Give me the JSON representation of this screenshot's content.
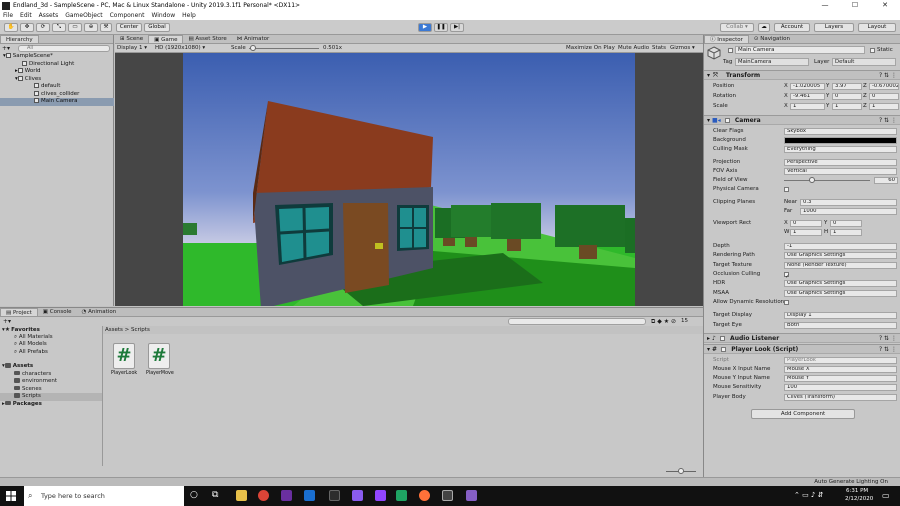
{
  "window": {
    "title": "Endland_3d - SampleScene - PC, Mac & Linux Standalone - Unity 2019.3.1f1 Personal* <DX11>",
    "controls": [
      "—",
      "☐",
      "✕"
    ]
  },
  "menu": [
    "File",
    "Edit",
    "Assets",
    "GameObject",
    "Component",
    "Window",
    "Help"
  ],
  "toolbar": {
    "pivot_label": "Center",
    "space_label": "Global",
    "collab_label": "Collab ▾",
    "account_label": "Account",
    "layers_label": "Layers",
    "layout_label": "Layout",
    "play_active": true
  },
  "hierarchy": {
    "tab_label": "Hierarchy",
    "search_placeholder": "All",
    "items": [
      {
        "label": "SampleScene*",
        "depth": 0,
        "expanded": true
      },
      {
        "label": "Directional Light",
        "depth": 1
      },
      {
        "label": "World",
        "depth": 1,
        "expandable": true
      },
      {
        "label": "Clives",
        "depth": 1,
        "expanded": true
      },
      {
        "label": "default",
        "depth": 2
      },
      {
        "label": "clives_collider",
        "depth": 2
      },
      {
        "label": "Main Camera",
        "depth": 2,
        "selected": true
      }
    ]
  },
  "view_tabs": [
    {
      "label": "Scene"
    },
    {
      "label": "Game",
      "selected": true
    },
    {
      "label": "Asset Store"
    },
    {
      "label": "Animator"
    }
  ],
  "game_bar": {
    "display": "Display 1",
    "resolution": "HD (1920x1080)",
    "scale_label": "Scale",
    "scale_value": "0.501x",
    "scale_fraction": 0.05,
    "maximize": "Maximize On Play",
    "mute": "Mute Audio",
    "stats": "Stats",
    "gizmos": "Gizmos"
  },
  "inspector": {
    "tabs": [
      {
        "label": "Inspector",
        "selected": true
      },
      {
        "label": "Navigation"
      }
    ],
    "object_name": "Main Camera",
    "static_label": "Static",
    "tag_label": "Tag",
    "tag_value": "MainCamera",
    "layer_label": "Layer",
    "layer_value": "Default",
    "transform": {
      "title": "Transform",
      "position": {
        "label": "Position",
        "x": "-1.020005",
        "y": "3.97",
        "z": "-0.670002"
      },
      "rotation": {
        "label": "Rotation",
        "x": "-9.461",
        "y": "0",
        "z": "0"
      },
      "scale": {
        "label": "Scale",
        "x": "1",
        "y": "1",
        "z": "1"
      }
    },
    "camera": {
      "title": "Camera",
      "clear_flags": {
        "label": "Clear Flags",
        "value": "Skybox"
      },
      "background": {
        "label": "Background",
        "color": "#000000"
      },
      "culling_mask": {
        "label": "Culling Mask",
        "value": "Everything"
      },
      "projection": {
        "label": "Projection",
        "value": "Perspective"
      },
      "fov_axis": {
        "label": "FOV Axis",
        "value": "Vertical"
      },
      "fov": {
        "label": "Field of View",
        "value": "60",
        "fraction": 0.33
      },
      "physical": {
        "label": "Physical Camera"
      },
      "clipping": {
        "label": "Clipping Planes",
        "near_label": "Near",
        "near": "0.3",
        "far_label": "Far",
        "far": "1000"
      },
      "viewport": {
        "label": "Viewport Rect",
        "x": "0",
        "y": "0",
        "w": "1",
        "h": "1"
      },
      "depth": {
        "label": "Depth",
        "value": "-1"
      },
      "rendering_path": {
        "label": "Rendering Path",
        "value": "Use Graphics Settings"
      },
      "target_texture": {
        "label": "Target Texture",
        "value": "None (Render Texture)"
      },
      "occlusion": {
        "label": "Occlusion Culling"
      },
      "hdr": {
        "label": "HDR",
        "value": "Use Graphics Settings"
      },
      "msaa": {
        "label": "MSAA",
        "value": "Use Graphics Settings"
      },
      "dynamic_res": {
        "label": "Allow Dynamic Resolution"
      },
      "target_display": {
        "label": "Target Display",
        "value": "Display 1"
      },
      "target_eye": {
        "label": "Target Eye",
        "value": "Both"
      }
    },
    "audio_listener": {
      "title": "Audio Listener"
    },
    "player_look": {
      "title": "Player Look (Script)",
      "script": {
        "label": "Script",
        "value": "PlayerLook"
      },
      "mouse_x": {
        "label": "Mouse X Input Name",
        "value": "Mouse X"
      },
      "mouse_y": {
        "label": "Mouse Y Input Name",
        "value": "Mouse Y"
      },
      "sensitivity": {
        "label": "Mouse Sensitivity",
        "value": "100"
      },
      "player_body": {
        "label": "Player Body",
        "value": "Clives (Transform)"
      }
    },
    "add_component": "Add Component"
  },
  "project": {
    "tabs": [
      {
        "label": "Project",
        "selected": true
      },
      {
        "label": "Console"
      },
      {
        "label": "Animation"
      }
    ],
    "tree": [
      {
        "label": "Favorites",
        "bold": true,
        "type": "fav"
      },
      {
        "label": "All Materials",
        "type": "search"
      },
      {
        "label": "All Models",
        "type": "search"
      },
      {
        "label": "All Prefabs",
        "type": "search"
      },
      {
        "label": "Assets",
        "bold": true,
        "type": "folder"
      },
      {
        "label": "characters",
        "type": "folder"
      },
      {
        "label": "environment",
        "type": "folder"
      },
      {
        "label": "Scenes",
        "type": "folder"
      },
      {
        "label": "Scripts",
        "type": "folder",
        "selected": true
      },
      {
        "label": "Packages",
        "bold": true,
        "type": "folder"
      }
    ],
    "breadcrumb": "Assets > Scripts",
    "assets": [
      {
        "label": "PlayerLook",
        "glyph": "#"
      },
      {
        "label": "PlayerMove",
        "glyph": "#"
      }
    ],
    "count_label": "15"
  },
  "status": {
    "text": "Auto Generate Lighting On"
  },
  "taskbar": {
    "search_placeholder": "Type here to search",
    "time": "6:31 PM",
    "date": "2/12/2020"
  },
  "colors": {
    "play_accent": "#3b79d4",
    "sky_top": "#3b5eb0",
    "sky_horizon": "#cfd0e6",
    "grass": "#2fb92b",
    "roof": "#8a3b1e",
    "wall": "#4d5266",
    "window": "#1f8f8f",
    "door": "#7a4a22",
    "tree": "#1b6e24"
  }
}
